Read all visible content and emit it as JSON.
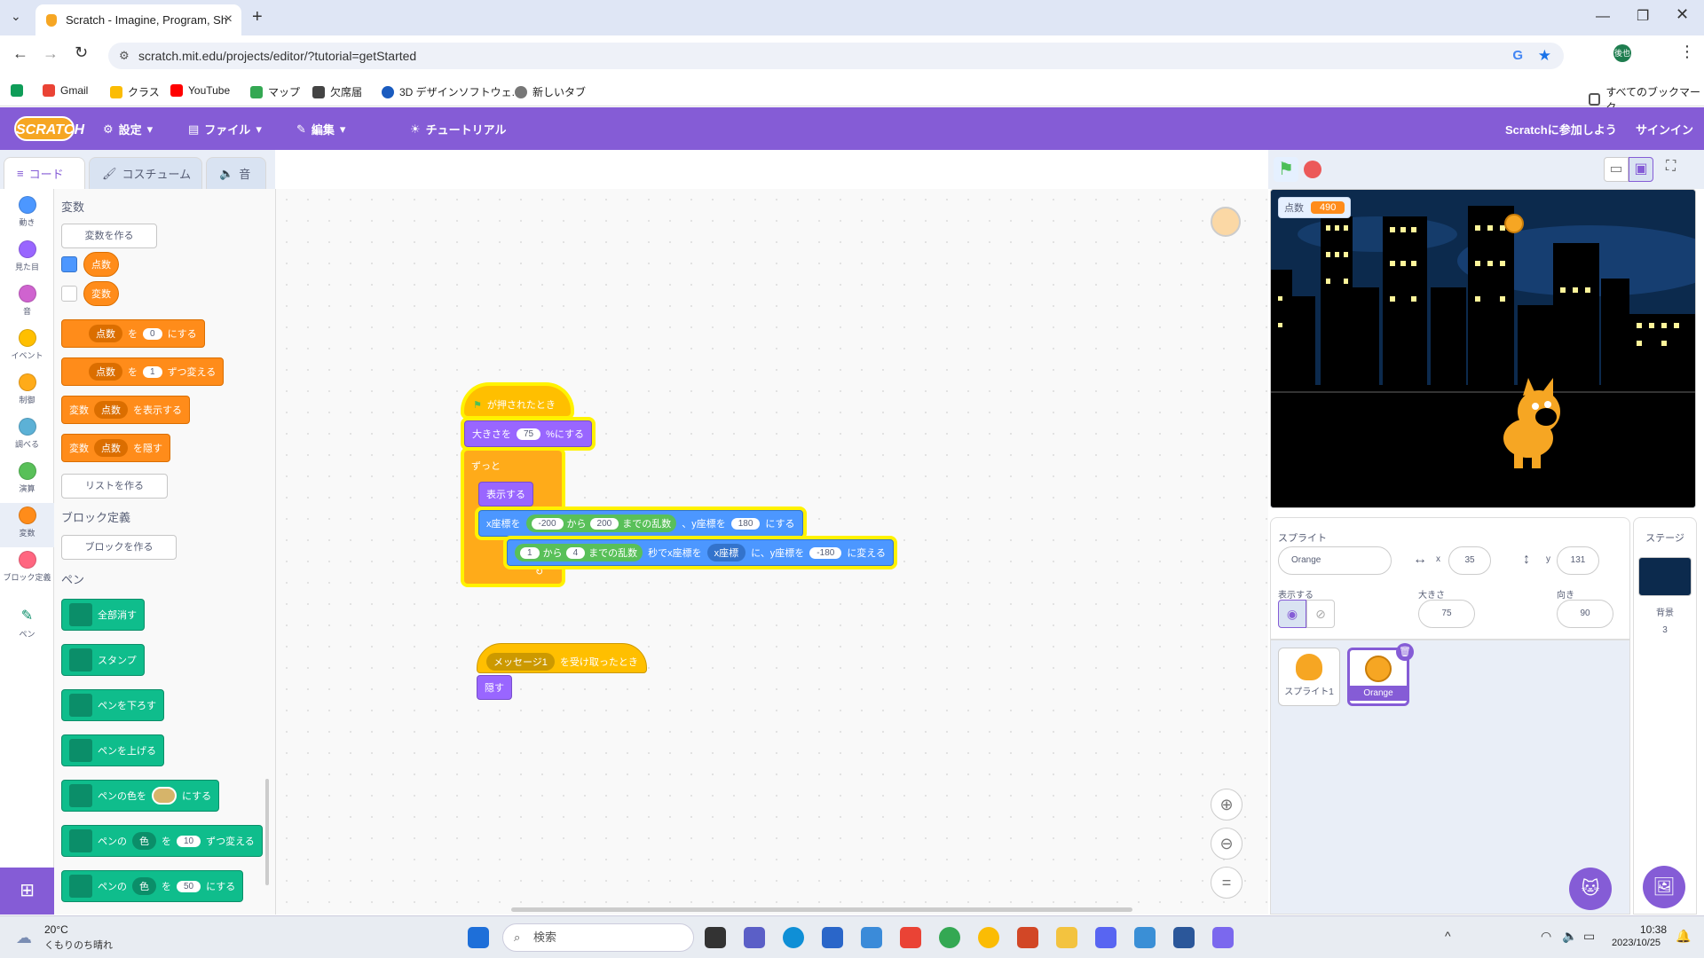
{
  "browser": {
    "tab_title": "Scratch - Imagine, Program, Sh",
    "url": "scratch.mit.edu/projects/editor/?tutorial=getStarted",
    "bookmarks": [
      "Gmail",
      "クラス",
      "YouTube",
      "マップ",
      "欠席届",
      "3D デザインソフトウェ...",
      "新しいタブ"
    ],
    "all_bookmarks": "すべてのブックマーク"
  },
  "menubar": {
    "logo": "SCRATCH",
    "settings": "設定",
    "file": "ファイル",
    "edit": "編集",
    "tutorial": "チュートリアル",
    "join": "Scratchに参加しよう",
    "signin": "サインイン"
  },
  "tabs": {
    "code": "コード",
    "costume": "コスチューム",
    "sound": "音"
  },
  "categories": [
    {
      "label": "動き",
      "color": "#4c97ff"
    },
    {
      "label": "見た目",
      "color": "#9966ff"
    },
    {
      "label": "音",
      "color": "#cf63cf"
    },
    {
      "label": "イベント",
      "color": "#ffbf00"
    },
    {
      "label": "制御",
      "color": "#ffab19"
    },
    {
      "label": "調べる",
      "color": "#5cb1d6"
    },
    {
      "label": "演算",
      "color": "#59c059"
    },
    {
      "label": "変数",
      "color": "#ff8c1a"
    },
    {
      "label": "ブロック定義",
      "color": "#ff6680"
    },
    {
      "label": "ペン",
      "color": "#0fbd8c"
    }
  ],
  "palette": {
    "variables_title": "変数",
    "make_variable": "変数を作る",
    "var1": "点数",
    "var2": "変数",
    "set_block": {
      "var": "点数",
      "to": "を",
      "value": "0",
      "suffix": "にする"
    },
    "change_block": {
      "var": "点数",
      "to": "を",
      "value": "1",
      "suffix": "ずつ変える"
    },
    "show_block": {
      "prefix": "変数",
      "var": "点数",
      "suffix": "を表示する"
    },
    "hide_block": {
      "prefix": "変数",
      "var": "点数",
      "suffix": "を隠す"
    },
    "make_list": "リストを作る",
    "my_blocks_title": "ブロック定義",
    "make_block": "ブロックを作る",
    "pen_title": "ペン",
    "pen_blocks": {
      "clear": "全部消す",
      "stamp": "スタンプ",
      "pen_down": "ペンを下ろす",
      "pen_up": "ペンを上げる",
      "set_color": "ペンの色を",
      "set_color_suffix": "にする",
      "change_prefix": "ペンの",
      "change_prop": "色",
      "change_to": "を",
      "change_value": "10",
      "change_suffix": "ずつ変える",
      "set_prefix": "ペンの",
      "set_prop": "色",
      "set_to": "を",
      "set_value": "50",
      "set_suffix": "にする"
    }
  },
  "script1": {
    "hat": "が押されたとき",
    "size_prefix": "大きさを",
    "size_value": "75",
    "size_suffix": "%にする",
    "forever": "ずっと",
    "show": "表示する",
    "goto_x": "x座標を",
    "rand1_min": "-200",
    "rand1_from": "から",
    "rand1_max": "200",
    "rand1_suffix": "までの乱数",
    "goto_y": "、y座標を",
    "goto_y_value": "180",
    "goto_suffix": "にする",
    "glide_min": "1",
    "glide_from": "から",
    "glide_max": "4",
    "glide_rand": "までの乱数",
    "glide_mid": "秒でx座標を",
    "glide_x": "x座標",
    "glide_mid2": "に、y座標を",
    "glide_y": "-180",
    "glide_suffix": "に変える"
  },
  "script2": {
    "message": "メッセージ1",
    "hat_suffix": "を受け取ったとき",
    "hide": "隠す"
  },
  "stage": {
    "monitor_label": "点数",
    "monitor_value": "490"
  },
  "sprite_info": {
    "sprite_label": "スプライト",
    "sprite_name": "Orange",
    "x_label": "x",
    "x_value": "35",
    "y_label": "y",
    "y_value": "131",
    "show_label": "表示する",
    "size_label": "大きさ",
    "size_value": "75",
    "direction_label": "向き",
    "direction_value": "90"
  },
  "sprites": [
    {
      "name": "スプライト1"
    },
    {
      "name": "Orange"
    }
  ],
  "stage_pane": {
    "title": "ステージ",
    "backdrops_label": "背景",
    "backdrops_count": "3"
  },
  "taskbar": {
    "temp": "20°C",
    "weather": "くもりのち晴れ",
    "search": "検索",
    "time": "10:38",
    "date": "2023/10/25"
  }
}
